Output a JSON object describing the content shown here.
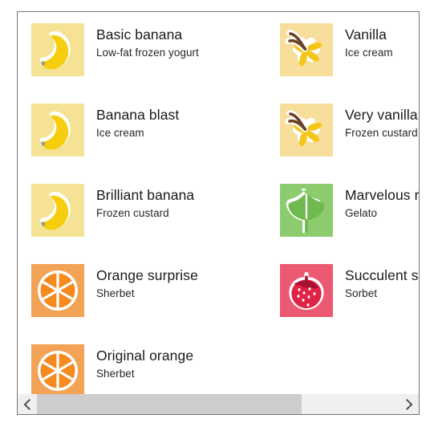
{
  "window": {
    "border_color": "#757575",
    "background": "#ffffff"
  },
  "list": {
    "items": [
      {
        "name": "Basic banana",
        "flavor": "Low-fat frozen yogurt",
        "icon": "banana-icon",
        "tile_color": "#F6E294",
        "art_color": "#F5CE0E",
        "column": 0,
        "row": 0,
        "truncated": false
      },
      {
        "name": "Banana blast",
        "flavor": "Ice cream",
        "icon": "banana-icon",
        "tile_color": "#F6E294",
        "art_color": "#F5CE0E",
        "column": 0,
        "row": 1,
        "truncated": false
      },
      {
        "name": "Brilliant banana",
        "flavor": "Frozen custard",
        "icon": "banana-icon",
        "tile_color": "#F6E294",
        "art_color": "#F5CE0E",
        "column": 0,
        "row": 2,
        "truncated": false
      },
      {
        "name": "Orange surprise",
        "flavor": "Sherbet",
        "icon": "orange-slice-icon",
        "tile_color": "#F2A355",
        "art_color": "#F58A1F",
        "column": 0,
        "row": 3,
        "truncated": false
      },
      {
        "name": "Original orange",
        "flavor": "Sherbet",
        "icon": "orange-slice-icon",
        "tile_color": "#F2A355",
        "art_color": "#F58A1F",
        "column": 0,
        "row": 4,
        "truncated": false
      },
      {
        "name": "Vanilla",
        "flavor": "Ice cream",
        "icon": "vanilla-flower-icon",
        "tile_color": "#F7DE9A",
        "art_color": "#F5C518",
        "column": 1,
        "row": 0,
        "truncated": false
      },
      {
        "name": "Very vanilla",
        "flavor": "Frozen custard",
        "icon": "vanilla-flower-icon",
        "tile_color": "#F7DE9A",
        "art_color": "#F5C518",
        "column": 1,
        "row": 1,
        "truncated": false
      },
      {
        "name": "Marvelous mint",
        "flavor": "Gelato",
        "icon": "mint-leaf-icon",
        "tile_color": "#8CCB6E",
        "art_color": "#6FB94F",
        "column": 1,
        "row": 2,
        "truncated": true
      },
      {
        "name": "Succulent strawberry",
        "flavor": "Sorbet",
        "icon": "strawberry-icon",
        "tile_color": "#EB5A72",
        "art_color": "#E02244",
        "column": 1,
        "row": 3,
        "truncated": true
      }
    ]
  },
  "scrollbar": {
    "orientation": "horizontal",
    "left_arrow": "chevron-left-icon",
    "right_arrow": "chevron-right-icon",
    "thumb_fraction": 0.73,
    "track_color": "#f0f0f0",
    "thumb_color": "#cdcdcd"
  }
}
